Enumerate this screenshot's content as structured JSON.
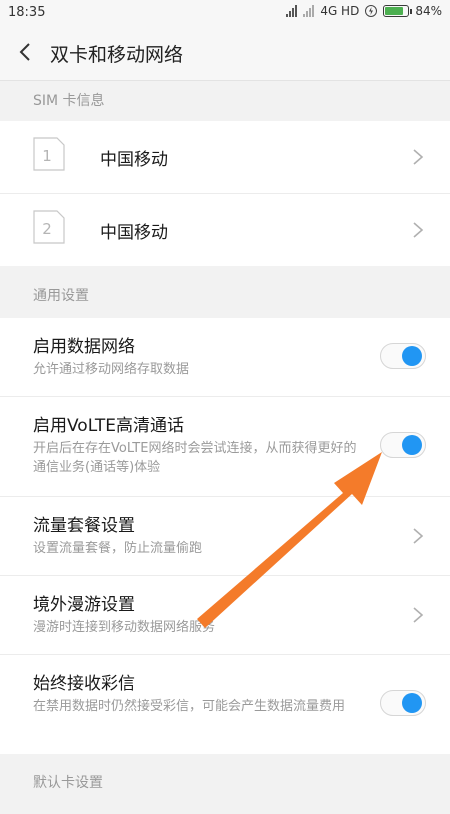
{
  "status_bar": {
    "time": "18:35",
    "network": "4G HD",
    "battery_percent_label": "84%",
    "battery_level": 0.84
  },
  "header": {
    "title": "双卡和移动网络"
  },
  "sim_section": {
    "title": "SIM 卡信息",
    "cards": [
      {
        "slot": "1",
        "name": "中国移动"
      },
      {
        "slot": "2",
        "name": "中国移动"
      }
    ]
  },
  "general_section": {
    "title": "通用设置",
    "items": [
      {
        "title": "启用数据网络",
        "desc": "允许通过移动网络存取数据",
        "control": "toggle",
        "on": true
      },
      {
        "title": "启用VoLTE高清通话",
        "desc": "开启后在存在VoLTE网络时会尝试连接，从而获得更好的通信业务(通话等)体验",
        "control": "toggle",
        "on": true
      },
      {
        "title": "流量套餐设置",
        "desc": "设置流量套餐，防止流量偷跑",
        "control": "chevron"
      },
      {
        "title": "境外漫游设置",
        "desc": "漫游时连接到移动数据网络服务",
        "control": "chevron"
      },
      {
        "title": "始终接收彩信",
        "desc": "在禁用数据时仍然接受彩信，可能会产生数据流量费用",
        "control": "toggle",
        "on": true
      }
    ]
  },
  "default_section": {
    "title": "默认卡设置"
  },
  "colors": {
    "toggle_on": "#2196f3",
    "annotation_arrow": "#f47b2a"
  }
}
